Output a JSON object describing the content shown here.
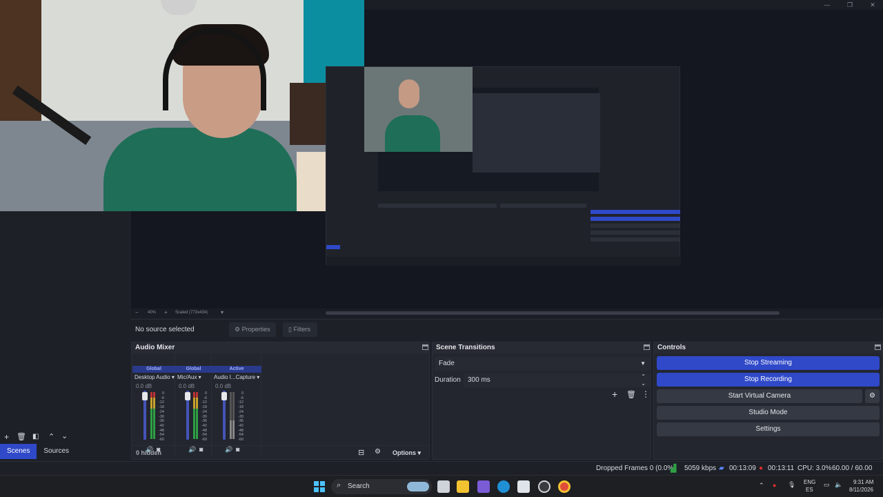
{
  "window": {
    "minimize": "—",
    "maximize": "❐",
    "close": "✕"
  },
  "preview": {
    "zoom_minus": "−",
    "zoom_level": "40%",
    "zoom_plus": "+",
    "scale_mode": "Scaled (773x434)",
    "scale_dropdown": "▾"
  },
  "source_bar": {
    "status": "No source selected",
    "properties": "Properties",
    "filters": "Filters"
  },
  "left_panel": {
    "tabs": [
      "Scenes",
      "Sources"
    ],
    "active_tab": "Scenes"
  },
  "audio_mixer": {
    "title": "Audio Mixer",
    "hidden_count": "0 hidden",
    "options": "Options",
    "scale_labels": [
      "0",
      "-6",
      "-12",
      "-18",
      "-24",
      "-30",
      "-36",
      "-42",
      "-48",
      "-54",
      "-60"
    ],
    "channels": [
      {
        "header": "Global",
        "name": "Desktop Audio",
        "db": "0.0 dB",
        "muted": false,
        "level": 0.72
      },
      {
        "header": "Global",
        "name": "Mic/Aux",
        "db": "0.0 dB",
        "muted": false,
        "level": 0.65
      },
      {
        "header": "Active",
        "name": "Audio I...Capture",
        "db": "0.0 dB",
        "muted": true,
        "level": 0.4
      }
    ]
  },
  "scene_transitions": {
    "title": "Scene Transitions",
    "transition": "Fade",
    "duration_label": "Duration",
    "duration_value": "300 ms"
  },
  "controls": {
    "title": "Controls",
    "stop_streaming": "Stop Streaming",
    "stop_recording": "Stop Recording",
    "start_virtual_camera": "Start Virtual Camera",
    "studio_mode": "Studio Mode",
    "settings": "Settings"
  },
  "status_bar": {
    "dropped_frames": "Dropped Frames 0 (0.0%)",
    "bitrate": "5059 kbps",
    "stream_time": "00:13:09",
    "record_time": "00:13:11",
    "cpu": "CPU: 3.0%",
    "fps": "60.00 / 60.00 FPS"
  },
  "taskbar": {
    "search_label": "Search",
    "lang_top": "ENG",
    "lang_bottom": "ES",
    "time": "9:31 AM",
    "date": "8/11/2026"
  },
  "colors": {
    "accent": "#2f49c9",
    "background": "#1d2027",
    "dock": "#23262e"
  }
}
